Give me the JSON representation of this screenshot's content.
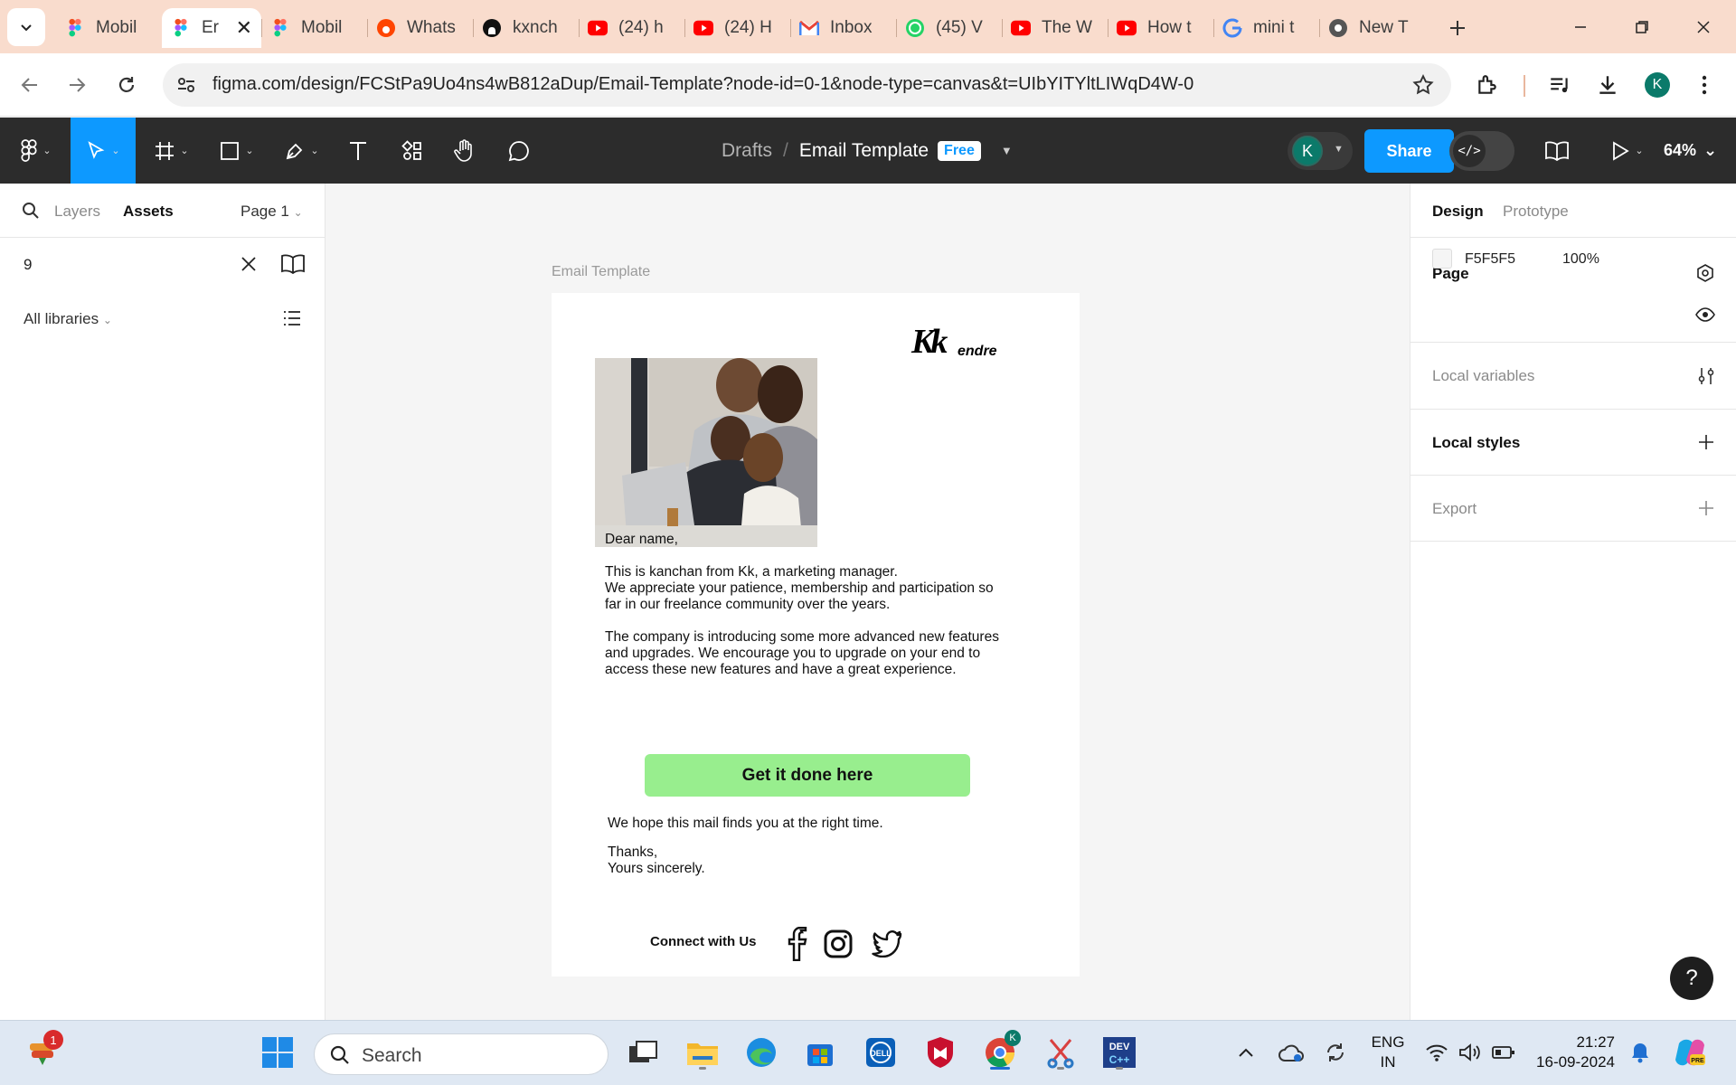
{
  "browser": {
    "tabs": [
      {
        "title": "Mobil",
        "icon": "figma-icon",
        "active": false
      },
      {
        "title": "Er",
        "icon": "figma-icon",
        "active": true
      },
      {
        "title": "Mobil",
        "icon": "figma-icon",
        "active": false
      },
      {
        "title": "Whats",
        "icon": "reddit-icon",
        "active": false
      },
      {
        "title": "kxnch",
        "icon": "github-icon",
        "active": false
      },
      {
        "title": "(24) h",
        "icon": "youtube-icon",
        "active": false
      },
      {
        "title": "(24) H",
        "icon": "youtube-icon",
        "active": false
      },
      {
        "title": "Inbox",
        "icon": "gmail-icon",
        "active": false
      },
      {
        "title": "(45) V",
        "icon": "whatsapp-icon",
        "active": false
      },
      {
        "title": "The W",
        "icon": "youtube-icon",
        "active": false
      },
      {
        "title": "How t",
        "icon": "youtube-icon",
        "active": false
      },
      {
        "title": "mini t",
        "icon": "google-icon",
        "active": false
      },
      {
        "title": "New T",
        "icon": "chrome-icon",
        "active": false
      }
    ],
    "url": "figma.com/design/FCStPa9Uo4ns4wB812aDup/Email-Template?node-id=0-1&node-type=canvas&t=UIbYITYltLIWqD4W-0",
    "profile_initial": "K",
    "colors": {
      "tabstrip": "#f9dccd"
    }
  },
  "figma": {
    "breadcrumb_drafts": "Drafts",
    "breadcrumb_sep": "/",
    "file_name": "Email Template",
    "plan_badge": "Free",
    "user_initial": "K",
    "share_label": "Share",
    "zoom": "64%",
    "dev_mode_glyph": "</>",
    "accent": "#0d99ff"
  },
  "left_panel": {
    "tab_layers": "Layers",
    "tab_assets": "Assets",
    "page_selector": "Page 1",
    "search_value": "9",
    "libraries_label": "All libraries"
  },
  "canvas": {
    "frame_label": "Email Template",
    "logo_text_main": "Kk",
    "logo_text_sub": "endre",
    "greeting": "Dear name,",
    "para1_line1": "This is kanchan from Kk, a marketing manager.",
    "para1_line2": "We appreciate your patience, membership and participation so",
    "para1_line3": "far in our freelance community over the years.",
    "para2_line1": "The company is introducing some more advanced new features",
    "para2_line2": "and upgrades. We encourage you to upgrade on your end to",
    "para2_line3": "access these new features and have a great experience.",
    "cta_label": "Get it done here",
    "closing": "We hope this mail finds you at the right time.",
    "thanks": "Thanks,",
    "signoff": "Yours sincerely.",
    "connect_label": "Connect with Us",
    "social_icons": [
      "facebook-icon",
      "instagram-icon",
      "twitter-icon"
    ],
    "cta_color": "#98ee8e"
  },
  "right_panel": {
    "tab_design": "Design",
    "tab_prototype": "Prototype",
    "page_section": "Page",
    "page_color_hex": "F5F5F5",
    "page_opacity": "100%",
    "local_variables": "Local variables",
    "local_styles": "Local styles",
    "export": "Export",
    "help": "?"
  },
  "taskbar": {
    "search_label": "Search",
    "notification_badge": "1",
    "language_line1": "ENG",
    "language_line2": "IN",
    "time": "21:27",
    "date": "16-09-2024"
  }
}
